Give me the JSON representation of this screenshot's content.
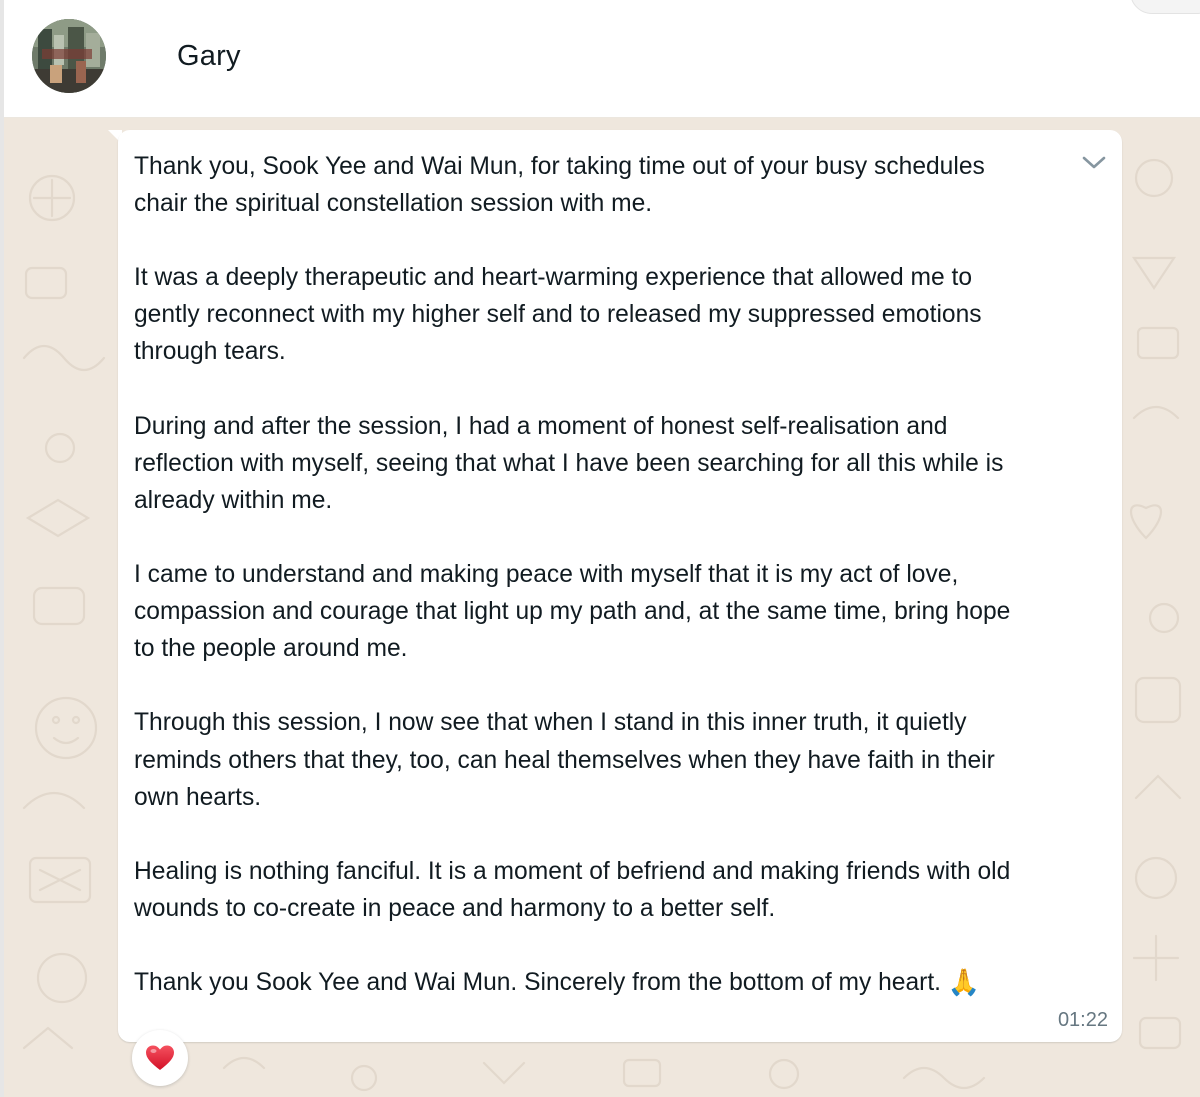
{
  "header": {
    "contact_name": "Gary",
    "avatar_icon": "contact-avatar"
  },
  "message": {
    "lines": [
      [
        "Thank you, Sook Yee and Wai Mun, for taking time out of your busy schedules",
        "chair the spiritual constellation session with me."
      ],
      [
        "It was a deeply therapeutic and heart-warming experience that allowed me to",
        "gently reconnect with my higher self and to released my suppressed emotions",
        "through tears."
      ],
      [
        "During and after the session, I had a moment of honest self-realisation and",
        "reflection with myself, seeing that what I have been searching for all this while is",
        "already within me."
      ],
      [
        "I came to understand and making peace with myself that it is my act of love,",
        "compassion and courage that light up my path and, at the same time, bring hope",
        "to the people around me."
      ],
      [
        "Through this session, I now see that when I stand in this inner truth, it quietly",
        "reminds others that they, too, can heal themselves when they have faith in their",
        "own hearts."
      ],
      [
        "Healing is nothing fanciful. It is a moment of befriend and making friends with old",
        "wounds to co-create in peace and harmony to a better self."
      ],
      [
        "Thank you Sook Yee and Wai Mun. Sincerely from the bottom of my heart. "
      ]
    ],
    "emoji": "🙏",
    "timestamp": "01:22",
    "menu_icon": "chevron-down-icon"
  },
  "reaction": {
    "emoji": "❤️",
    "icon": "heart-icon"
  },
  "colors": {
    "chat_background": "#efe7dd",
    "bubble": "#ffffff",
    "text": "#111b21",
    "timestamp": "#667781",
    "heart": "#e5243b"
  }
}
